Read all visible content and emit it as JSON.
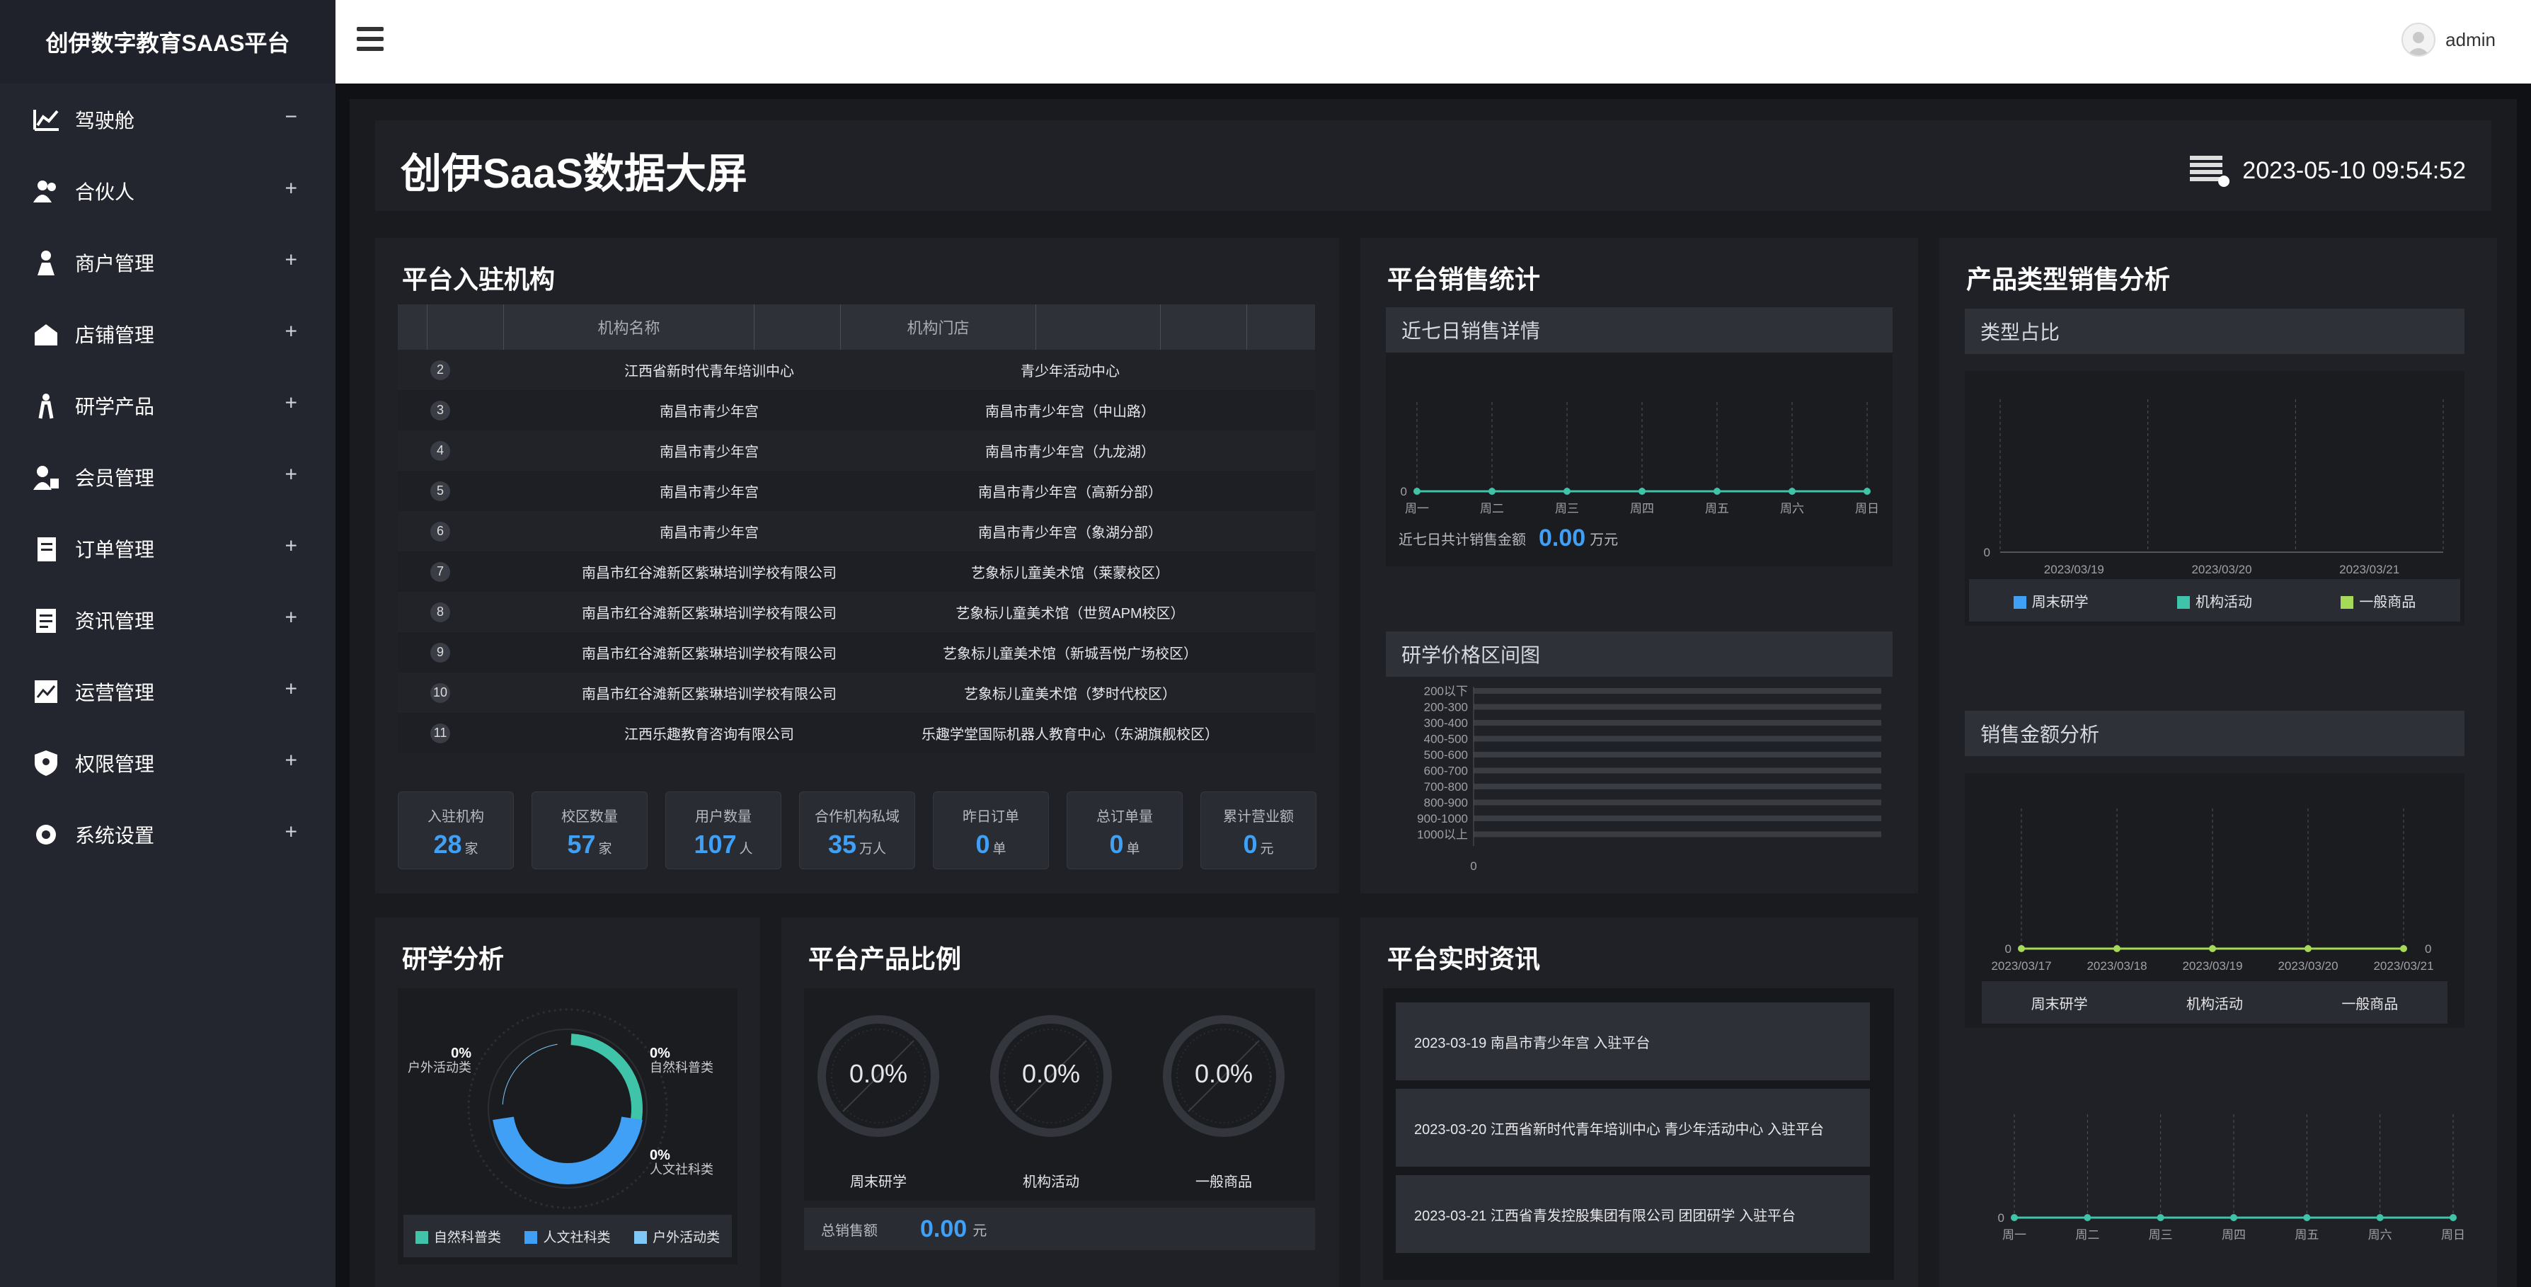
{
  "brand": "创伊数字教育SAAS平台",
  "nav": [
    {
      "label": "驾驶舱",
      "sign": "−",
      "icon": "chart-line-icon"
    },
    {
      "label": "合伙人",
      "sign": "+",
      "icon": "partner-icon"
    },
    {
      "label": "商户管理",
      "sign": "+",
      "icon": "merchant-icon"
    },
    {
      "label": "店铺管理",
      "sign": "+",
      "icon": "store-icon"
    },
    {
      "label": "研学产品",
      "sign": "+",
      "icon": "product-icon"
    },
    {
      "label": "会员管理",
      "sign": "+",
      "icon": "member-icon"
    },
    {
      "label": "订单管理",
      "sign": "+",
      "icon": "order-icon"
    },
    {
      "label": "资讯管理",
      "sign": "+",
      "icon": "news-icon"
    },
    {
      "label": "运营管理",
      "sign": "+",
      "icon": "operation-icon"
    },
    {
      "label": "权限管理",
      "sign": "+",
      "icon": "shield-icon"
    },
    {
      "label": "系统设置",
      "sign": "+",
      "icon": "gear-icon"
    }
  ],
  "user": "admin",
  "dashboard": {
    "title": "创伊SaaS数据大屏",
    "datetime": "2023-05-10 09:54:52"
  },
  "institutions": {
    "title": "平台入驻机构",
    "headers": [
      "机构名称",
      "机构门店"
    ],
    "rows": [
      {
        "no": "2",
        "name": "江西省新时代青年培训中心",
        "store": "青少年活动中心"
      },
      {
        "no": "3",
        "name": "南昌市青少年宫",
        "store": "南昌市青少年宫（中山路）"
      },
      {
        "no": "4",
        "name": "南昌市青少年宫",
        "store": "南昌市青少年宫（九龙湖）"
      },
      {
        "no": "5",
        "name": "南昌市青少年宫",
        "store": "南昌市青少年宫（高新分部）"
      },
      {
        "no": "6",
        "name": "南昌市青少年宫",
        "store": "南昌市青少年宫（象湖分部）"
      },
      {
        "no": "7",
        "name": "南昌市红谷滩新区紫琳培训学校有限公司",
        "store": "艺象标儿童美术馆（莱蒙校区）"
      },
      {
        "no": "8",
        "name": "南昌市红谷滩新区紫琳培训学校有限公司",
        "store": "艺象标儿童美术馆（世贸APM校区）"
      },
      {
        "no": "9",
        "name": "南昌市红谷滩新区紫琳培训学校有限公司",
        "store": "艺象标儿童美术馆（新城吾悦广场校区）"
      },
      {
        "no": "10",
        "name": "南昌市红谷滩新区紫琳培训学校有限公司",
        "store": "艺象标儿童美术馆（梦时代校区）"
      },
      {
        "no": "11",
        "name": "江西乐趣教育咨询有限公司",
        "store": "乐趣学堂国际机器人教育中心（东湖旗舰校区）"
      }
    ],
    "stats": [
      {
        "label": "入驻机构",
        "value": "28",
        "unit": "家"
      },
      {
        "label": "校区数量",
        "value": "57",
        "unit": "家"
      },
      {
        "label": "用户数量",
        "value": "107",
        "unit": "人"
      },
      {
        "label": "合作机构私域",
        "value": "35",
        "unit": "万人"
      },
      {
        "label": "昨日订单",
        "value": "0",
        "unit": "单"
      },
      {
        "label": "总订单量",
        "value": "0",
        "unit": "单"
      },
      {
        "label": "累计营业额",
        "value": "0",
        "unit": "元"
      }
    ]
  },
  "sales": {
    "title": "平台销售统计",
    "weekly_title": "近七日销售详情",
    "total_label": "近七日共计销售金额",
    "total_value": "0.00",
    "total_unit": "万元",
    "price_title": "研学价格区间图"
  },
  "type_analysis": {
    "title": "产品类型销售分析",
    "share_title": "类型占比",
    "amount_title": "销售金额分析",
    "amount_legend": [
      "周末研学",
      "机构活动",
      "一般商品"
    ]
  },
  "study": {
    "title": "研学分析",
    "labels": [
      {
        "pct": "0%",
        "name": "户外活动类"
      },
      {
        "pct": "0%",
        "name": "自然科普类"
      },
      {
        "pct": "0%",
        "name": "人文社科类"
      }
    ]
  },
  "ratio": {
    "title": "平台产品比例",
    "gauges": [
      {
        "value": "0.0%",
        "label": "周末研学"
      },
      {
        "value": "0.0%",
        "label": "机构活动"
      },
      {
        "value": "0.0%",
        "label": "一般商品"
      }
    ],
    "total_label": "总销售额",
    "total_value": "0.00",
    "total_unit": "元"
  },
  "news": {
    "title": "平台实时资讯",
    "items": [
      "2023-03-19 南昌市青少年宫 入驻平台",
      "2023-03-20 江西省新时代青年培训中心 青少年活动中心 入驻平台",
      "2023-03-21 江西省青发控股集团有限公司 团团研学 入驻平台"
    ]
  },
  "colors": {
    "teal": "#3fc4a9",
    "blue": "#3fa0f5",
    "green": "#a6d957",
    "lightblue": "#7fc7f7"
  },
  "chart_data": [
    {
      "type": "line",
      "title": "近七日销售详情",
      "categories": [
        "周一",
        "周二",
        "周三",
        "周四",
        "周五",
        "周六",
        "周日"
      ],
      "values": [
        0,
        0,
        0,
        0,
        0,
        0,
        0
      ],
      "yticks": [
        "0"
      ]
    },
    {
      "type": "bar",
      "title": "研学价格区间图",
      "orientation": "horizontal",
      "categories": [
        "200以下",
        "200-300",
        "300-400",
        "400-500",
        "500-600",
        "600-700",
        "700-800",
        "800-900",
        "900-1000",
        "1000以上"
      ],
      "values": [
        0,
        0,
        0,
        0,
        0,
        0,
        0,
        0,
        0,
        0
      ],
      "xticks": [
        "0"
      ]
    },
    {
      "type": "bar",
      "title": "类型占比",
      "categories": [
        "2023/03/19",
        "2023/03/20",
        "2023/03/21"
      ],
      "series": [
        {
          "name": "周末研学",
          "values": [
            0,
            0,
            0
          ]
        },
        {
          "name": "机构活动",
          "values": [
            0,
            0,
            0
          ]
        },
        {
          "name": "一般商品",
          "values": [
            0,
            0,
            0
          ]
        }
      ],
      "yticks": [
        "0"
      ]
    },
    {
      "type": "line",
      "title": "销售金额分析",
      "categories": [
        "2023/03/17",
        "2023/03/18",
        "2023/03/19",
        "2023/03/20",
        "2023/03/21"
      ],
      "values": [
        0,
        0,
        0,
        0,
        0
      ],
      "yticks": [
        "0"
      ]
    },
    {
      "type": "line",
      "categories": [
        "周一",
        "周二",
        "周三",
        "周四",
        "周五",
        "周六",
        "周日"
      ],
      "values": [
        0,
        0,
        0,
        0,
        0,
        0,
        0
      ],
      "yticks": [
        "0"
      ]
    },
    {
      "type": "pie",
      "title": "研学分析",
      "categories": [
        "自然科普类",
        "人文社科类",
        "户外活动类"
      ],
      "values": [
        0,
        0,
        0
      ]
    }
  ]
}
